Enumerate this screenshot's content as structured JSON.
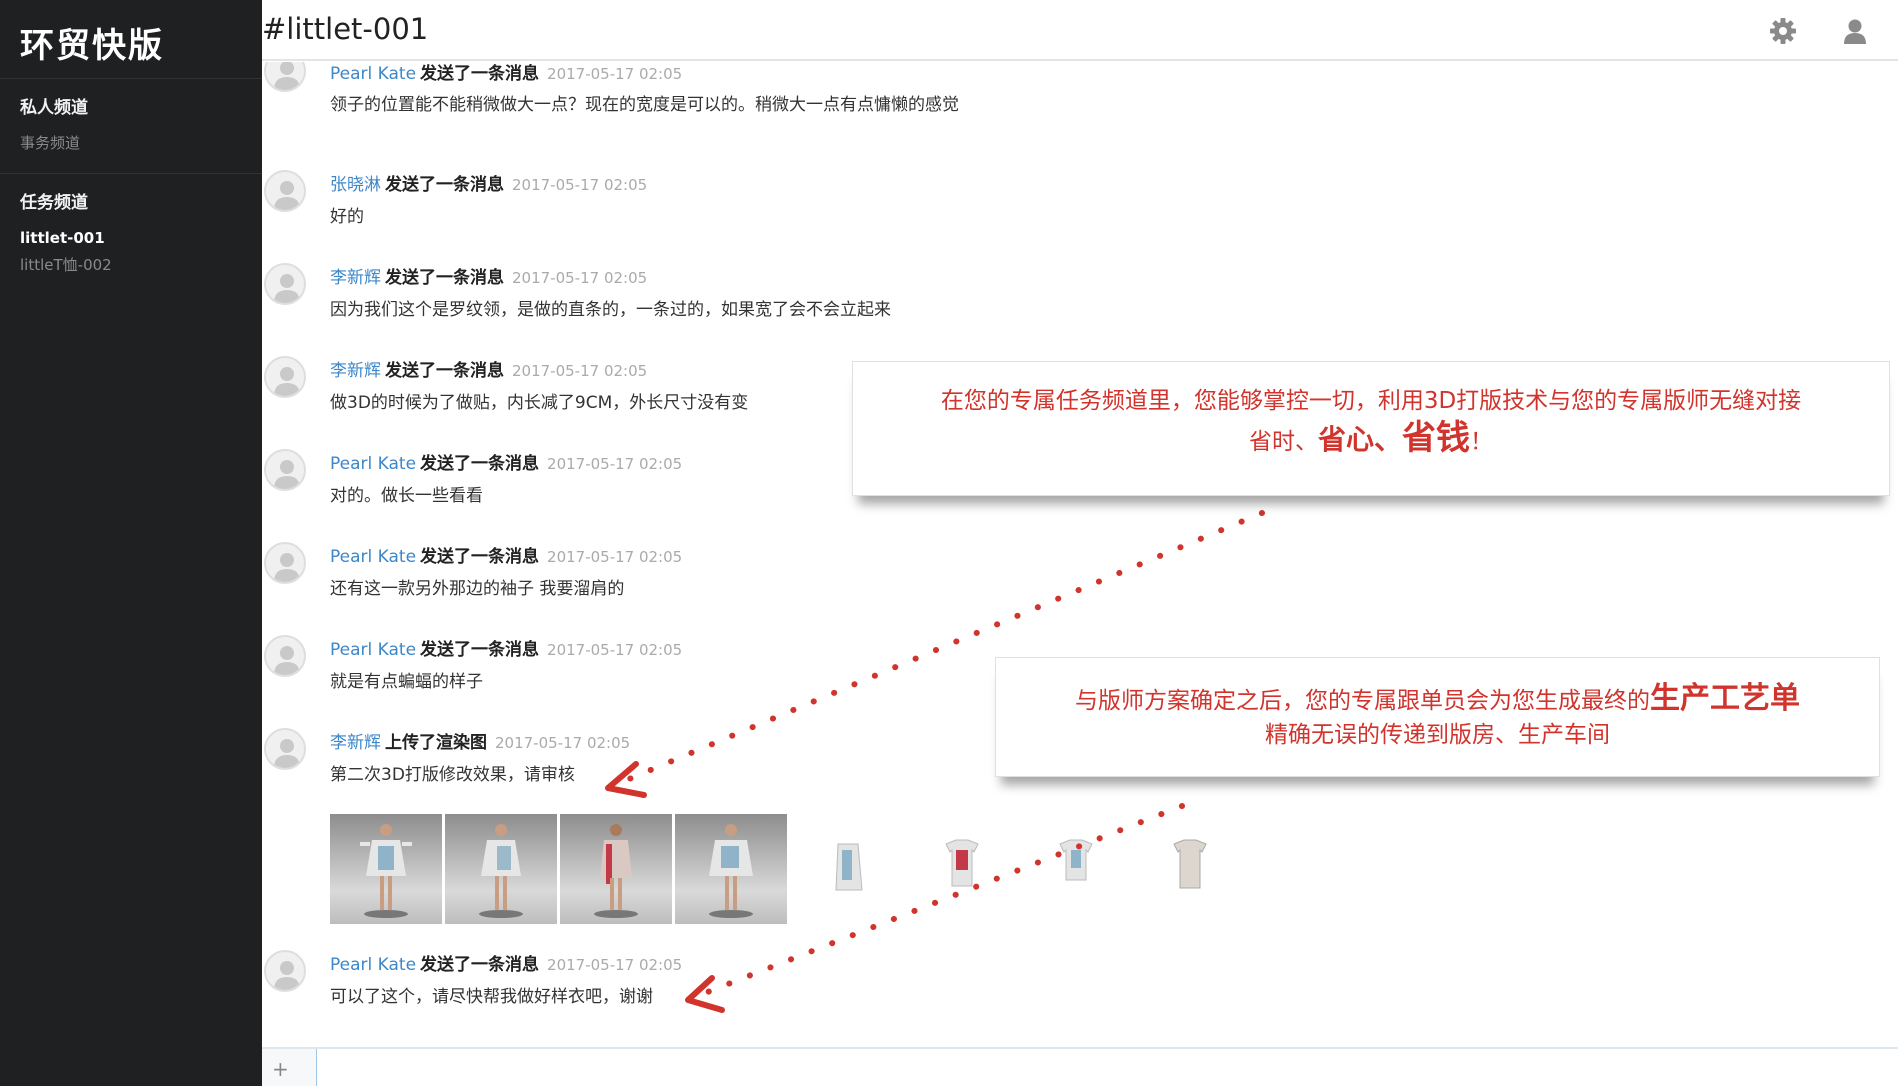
{
  "app": {
    "brand": "环贸快版"
  },
  "sidebar": {
    "private_title": "私人频道",
    "private_items": [
      "事务频道"
    ],
    "task_title": "任务频道",
    "task_items": [
      {
        "label": "littlet-001",
        "active": true
      },
      {
        "label": "littleT恤-002",
        "active": false
      }
    ]
  },
  "header": {
    "channel_title": "#littlet-001"
  },
  "messages": [
    {
      "author": "Pearl Kate",
      "action": "发送了一条消息",
      "time": "2017-05-17 02:05",
      "text": "领子的位置能不能稍微做大一点？现在的宽度是可以的。稍微大一点有点慵懒的感觉"
    },
    {
      "author": "张晓淋",
      "action": "发送了一条消息",
      "time": "2017-05-17 02:05",
      "text": "好的"
    },
    {
      "author": "李新辉",
      "action": "发送了一条消息",
      "time": "2017-05-17 02:05",
      "text": "因为我们这个是罗纹领，是做的直条的，一条过的，如果宽了会不会立起来"
    },
    {
      "author": "李新辉",
      "action": "发送了一条消息",
      "time": "2017-05-17 02:05",
      "text": "做3D的时候为了做贴，内长减了9CM，外长尺寸没有变"
    },
    {
      "author": "Pearl Kate",
      "action": "发送了一条消息",
      "time": "2017-05-17 02:05",
      "text": "对的。做长一些看看"
    },
    {
      "author": "Pearl Kate",
      "action": "发送了一条消息",
      "time": "2017-05-17 02:05",
      "text": "还有这一款另外那边的袖子 我要溜肩的"
    },
    {
      "author": "Pearl Kate",
      "action": "发送了一条消息",
      "time": "2017-05-17 02:05",
      "text": "就是有点蝙蝠的样子"
    },
    {
      "author": "李新辉",
      "action": "上传了渲染图",
      "time": "2017-05-17 02:05",
      "text": "第二次3D打版修改效果，请审核"
    },
    {
      "author": "Pearl Kate",
      "action": "发送了一条消息",
      "time": "2017-05-17 02:05",
      "text": "可以了这个，请尽快帮我做好样衣吧，谢谢"
    }
  ],
  "callout1": {
    "line1": "在您的专属任务频道里，您能够掌控一切，利用3D打版技术与您的专属版师无缝对接",
    "w1": "省时、",
    "w2": "省心、",
    "w3": "省钱",
    "end": "！"
  },
  "callout2": {
    "line1_prefix": "与版师方案确定之后，您的专属跟单员会为您生成最终的",
    "line1_emph": "生产工艺单",
    "line2": "精确无误的传递到版房、生产车间"
  },
  "composer": {
    "plus": "+",
    "placeholder": ""
  },
  "colors": {
    "sidebar_bg": "#1f2022",
    "author_link": "#3d87c9",
    "callout_red": "#d0342c"
  }
}
